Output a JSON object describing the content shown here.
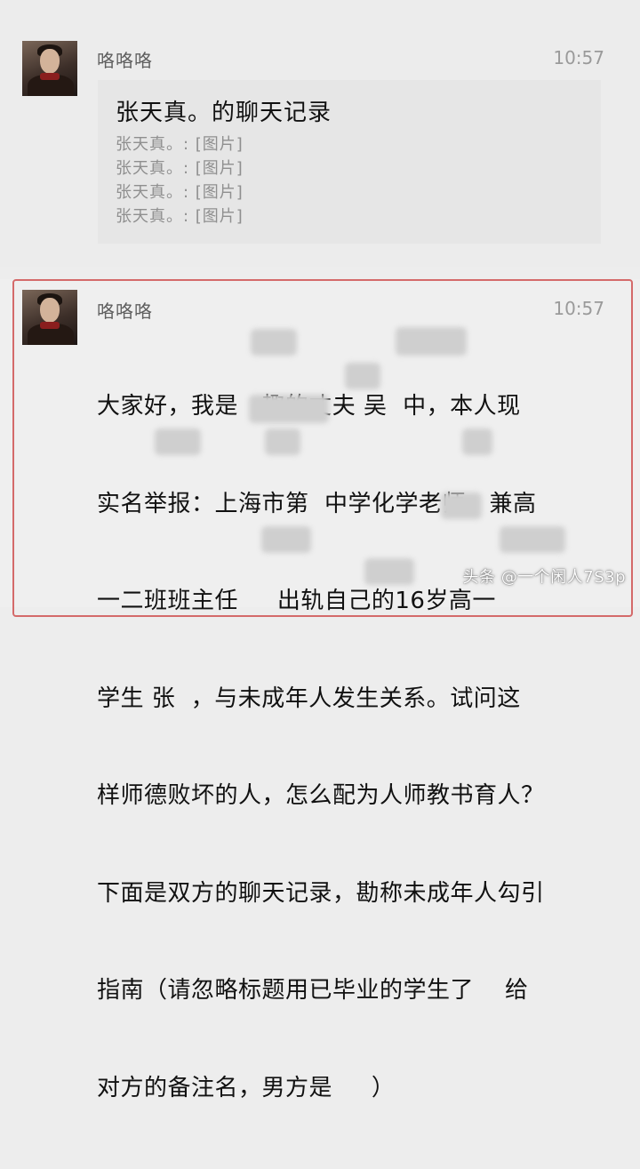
{
  "messages": [
    {
      "sender": "咯咯咯",
      "time": "10:57",
      "card": {
        "title": "张天真。的聊天记录",
        "lines": [
          "张天真。: [图片]",
          "张天真。: [图片]",
          "张天真。: [图片]",
          "张天真。: [图片]"
        ]
      }
    },
    {
      "sender": "咯咯咯",
      "time": "10:57",
      "text_lines": [
        "大家好，我是   趣的丈夫 吴  中，本人现",
        "实名举报：上海市第  中学化学老师、兼高",
        "一二班班主任     出轨自己的16岁高一",
        "学生 张  ，与未成年人发生关系。试问这",
        "样师德败坏的人，怎么配为人师教书育人？",
        "下面是双方的聊天记录，勘称未成年人勾引",
        "指南（请忽略标题用已毕业的学生了    给",
        "对方的备注名，男方是     ）"
      ]
    }
  ],
  "watermark": "头条 @一个闲人7S3p"
}
